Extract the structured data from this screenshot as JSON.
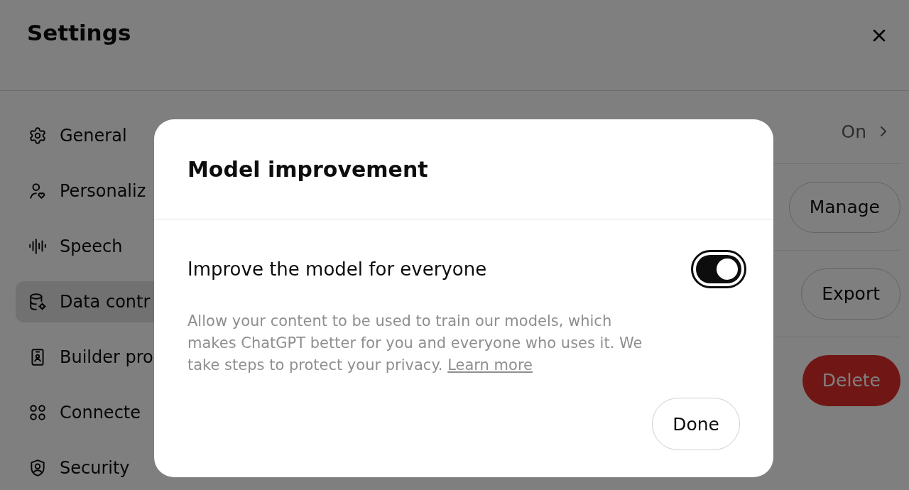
{
  "window": {
    "title": "Settings"
  },
  "sidebar": {
    "items": [
      {
        "label": "General",
        "selected": false
      },
      {
        "label": "Personaliz",
        "selected": false
      },
      {
        "label": "Speech",
        "selected": false
      },
      {
        "label": "Data contr",
        "selected": true
      },
      {
        "label": "Builder pro",
        "selected": false
      },
      {
        "label": "Connecte",
        "selected": false
      },
      {
        "label": "Security",
        "selected": false
      }
    ]
  },
  "panel": {
    "rows": [
      {
        "kind": "value",
        "text": "On"
      },
      {
        "kind": "button",
        "text": "Manage"
      },
      {
        "kind": "button",
        "text": "Export"
      },
      {
        "kind": "danger",
        "text": "Delete"
      }
    ]
  },
  "dialog": {
    "title": "Model improvement",
    "setting": {
      "label": "Improve the model for everyone",
      "on": true
    },
    "description": "Allow your content to be used to train our models, which makes ChatGPT better for you and everyone who uses it. We take steps to protect your privacy.",
    "link": "Learn more",
    "button": "Done"
  }
}
